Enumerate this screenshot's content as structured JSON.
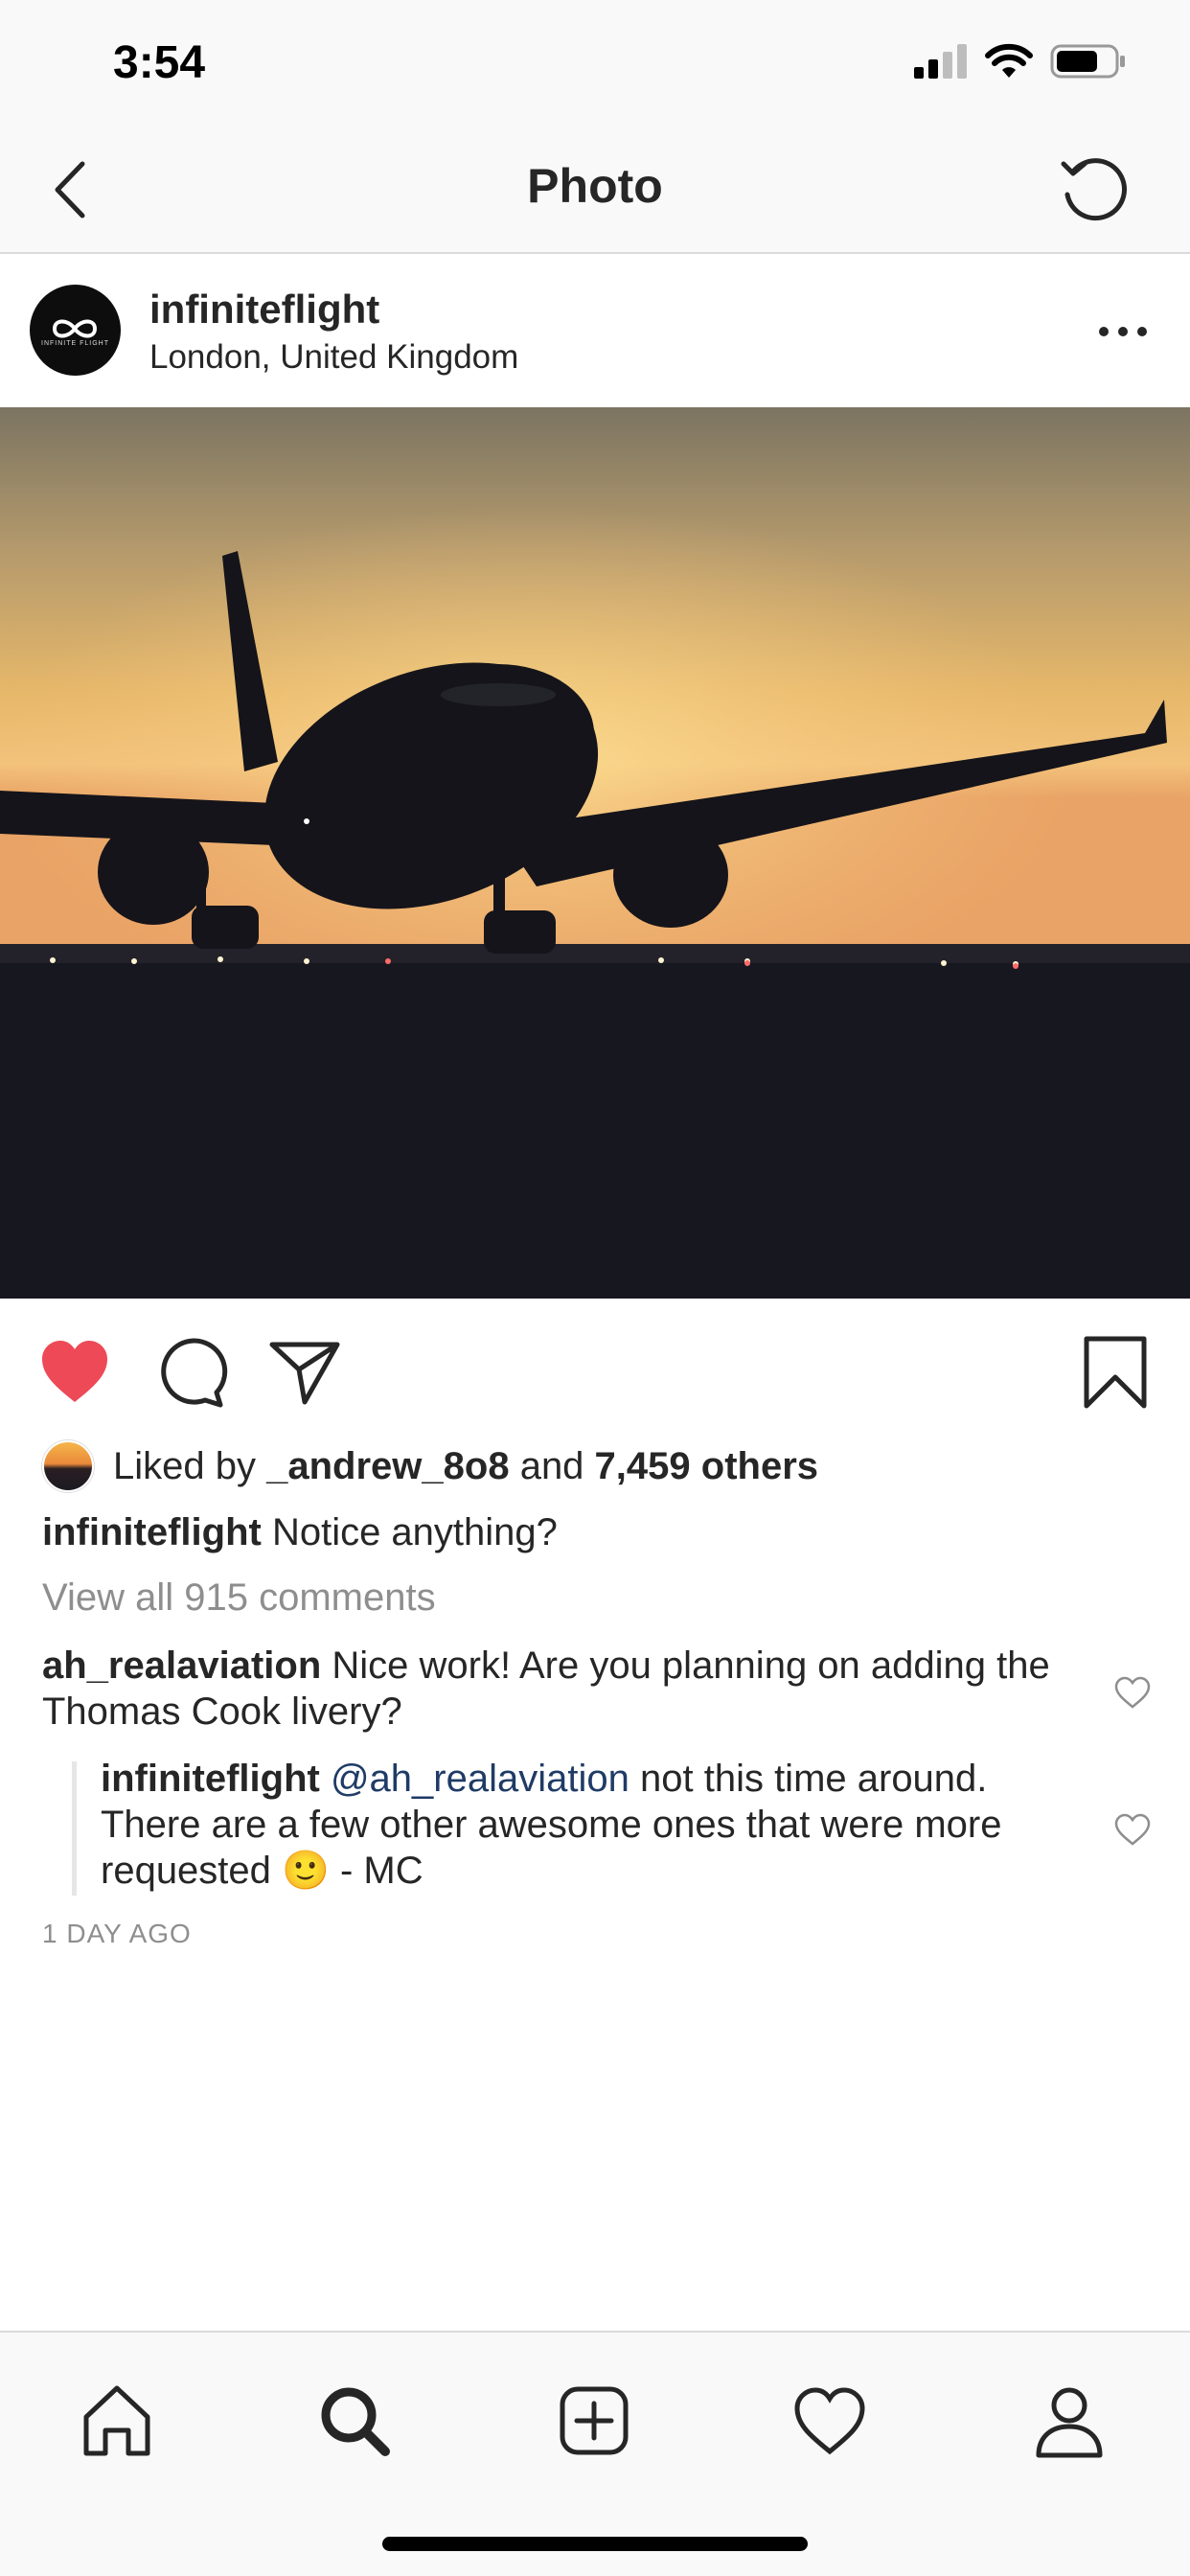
{
  "status_bar": {
    "time": "3:54"
  },
  "nav": {
    "title": "Photo"
  },
  "post": {
    "username": "infiniteflight",
    "location": "London, United Kingdom",
    "avatar_text": "INFINITE FLIGHT",
    "liked": true,
    "likes": {
      "prefix": "Liked by ",
      "first_user": "_andrew_8o8",
      "connector": " and ",
      "others": "7,459 others"
    },
    "caption": {
      "user": "infiniteflight",
      "text": " Notice anything?"
    },
    "view_all_comments": "View all 915 comments",
    "comments": [
      {
        "user": "ah_realaviation",
        "text": " Nice work! Are you planning on adding the Thomas Cook livery?"
      },
      {
        "user": "infiniteflight",
        "mention": "@ah_realaviation",
        "text": " not this time around. There are a few other awesome ones that were more requested 🙂 - MC",
        "is_reply": true
      }
    ],
    "time_ago": "1 DAY AGO"
  },
  "colors": {
    "like_red": "#ed4956",
    "text": "#262626",
    "muted": "#8e8e8e",
    "mention": "#1f3b66"
  },
  "icons": [
    "back-icon",
    "refresh-icon",
    "more-icon",
    "heart-icon",
    "comment-icon",
    "share-icon",
    "bookmark-icon",
    "home-icon",
    "search-icon",
    "add-icon",
    "activity-icon",
    "profile-icon"
  ]
}
